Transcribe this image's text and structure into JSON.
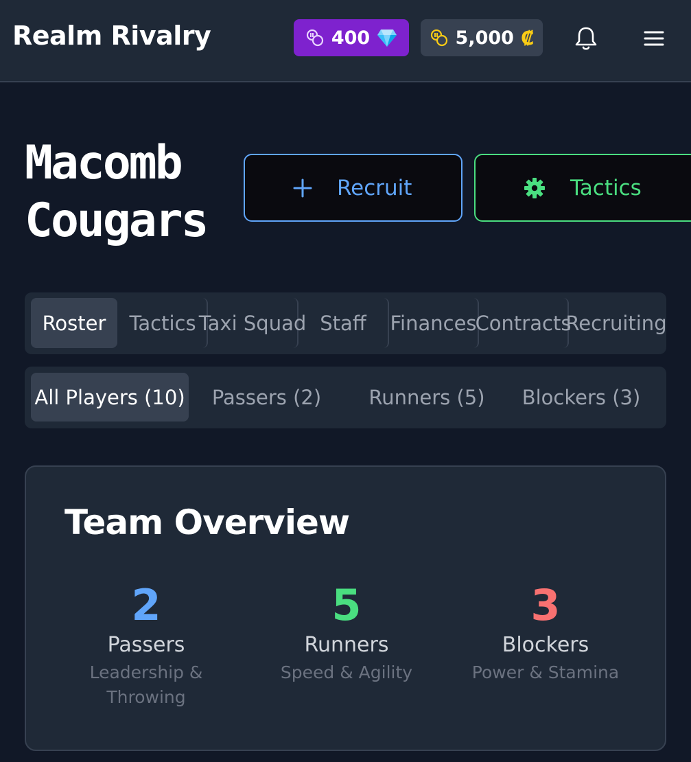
{
  "header": {
    "title": "Realm Rivalry",
    "gems": "400",
    "credits": "5,000",
    "credit_symbol": "₡"
  },
  "team": {
    "name": "Macomb Cougars"
  },
  "actions": {
    "recruit_label": "Recruit",
    "tactics_label": "Tactics"
  },
  "tabs": [
    {
      "label": "Roster",
      "active": true
    },
    {
      "label": "Tactics"
    },
    {
      "label": "Taxi Squad"
    },
    {
      "label": "Staff"
    },
    {
      "label": "Finances"
    },
    {
      "label": "Contracts"
    },
    {
      "label": "Recruiting"
    }
  ],
  "filters": [
    {
      "label": "All Players (10)",
      "active": true
    },
    {
      "label": "Passers (2)"
    },
    {
      "label": "Runners (5)"
    },
    {
      "label": "Blockers (3)"
    }
  ],
  "overview": {
    "title": "Team Overview",
    "stats": [
      {
        "count": "2",
        "label": "Passers",
        "sub": "Leadership & Throwing",
        "color": "#60a5fa"
      },
      {
        "count": "5",
        "label": "Runners",
        "sub": "Speed & Agility",
        "color": "#4ade80"
      },
      {
        "count": "3",
        "label": "Blockers",
        "sub": "Power & Stamina",
        "color": "#f87171"
      }
    ]
  },
  "colors": {
    "gems_pill": "#7e22ce",
    "coins_pill": "#374151",
    "recruit_accent": "#60a5fa",
    "tactics_accent": "#4ade80"
  },
  "icons": {
    "gems_pill": "coins-icon",
    "gem": "gem-icon",
    "coins_pill": "coins-icon",
    "bell": "bell-icon",
    "menu": "menu-icon",
    "recruit": "plus-icon",
    "tactics": "gear-icon"
  }
}
